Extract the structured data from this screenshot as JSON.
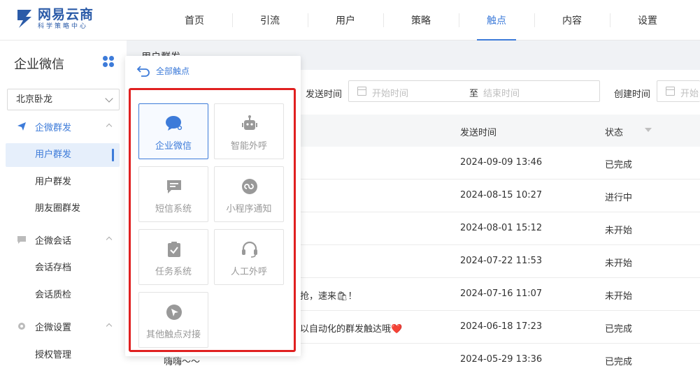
{
  "brand": {
    "title": "网易云商",
    "subtitle": "科学策略中心"
  },
  "nav": [
    "首页",
    "引流",
    "用户",
    "策略",
    "触点",
    "内容",
    "设置"
  ],
  "nav_active_index": 4,
  "sidebar": {
    "title": "企业微信",
    "org_select": "北京卧龙",
    "groups": [
      {
        "label": "企微群发",
        "items": [
          "用户群发",
          "用户群发",
          "朋友圈群发"
        ]
      },
      {
        "label": "企微会话",
        "items": [
          "会话存档",
          "会话质检"
        ]
      },
      {
        "label": "企微设置",
        "items": [
          "授权管理"
        ]
      }
    ]
  },
  "main": {
    "page_title": "用户群发",
    "filters": {
      "send_time_label": "发送时间",
      "start_placeholder": "开始时间",
      "range_sep": "至",
      "end_placeholder": "结束时间",
      "create_time_label": "创建时间",
      "create_start_placeholder": "开始"
    },
    "table": {
      "headers": {
        "send_time": "发送时间",
        "status": "状态"
      },
      "rows": [
        {
          "content": "",
          "send_time": "2024-09-09 13:46",
          "status": "已完成"
        },
        {
          "content": "",
          "send_time": "2024-08-15 10:27",
          "status": "进行中"
        },
        {
          "content": "",
          "send_time": "2024-08-01 15:12",
          "status": "未开始"
        },
        {
          "content": "",
          "send_time": "2024-07-22 11:53",
          "status": "未开始"
        },
        {
          "content": "抢，速来🛍！",
          "send_time": "2024-07-16 11:07",
          "status": "未开始"
        },
        {
          "content": "以自动化的群发触达哦❤️",
          "send_time": "2024-06-18 17:23",
          "status": "已完成"
        },
        {
          "content": "嗨嗨～～",
          "send_time": "2024-05-29 13:36",
          "status": "已完成"
        }
      ]
    }
  },
  "popup": {
    "back_label": "全部触点",
    "cards": [
      {
        "label": "企业微信",
        "icon": "wechat-work-icon",
        "active": true
      },
      {
        "label": "智能外呼",
        "icon": "robot-icon",
        "active": false
      },
      {
        "label": "短信系统",
        "icon": "sms-icon",
        "active": false
      },
      {
        "label": "小程序通知",
        "icon": "mini-program-icon",
        "active": false
      },
      {
        "label": "任务系统",
        "icon": "task-icon",
        "active": false
      },
      {
        "label": "人工外呼",
        "icon": "headset-icon",
        "active": false
      },
      {
        "label": "其他触点对接",
        "icon": "cursor-icon",
        "active": false
      }
    ]
  },
  "colors": {
    "accent": "#3d7bd9",
    "highlight_border": "#e02020",
    "muted_icon": "#999999"
  }
}
